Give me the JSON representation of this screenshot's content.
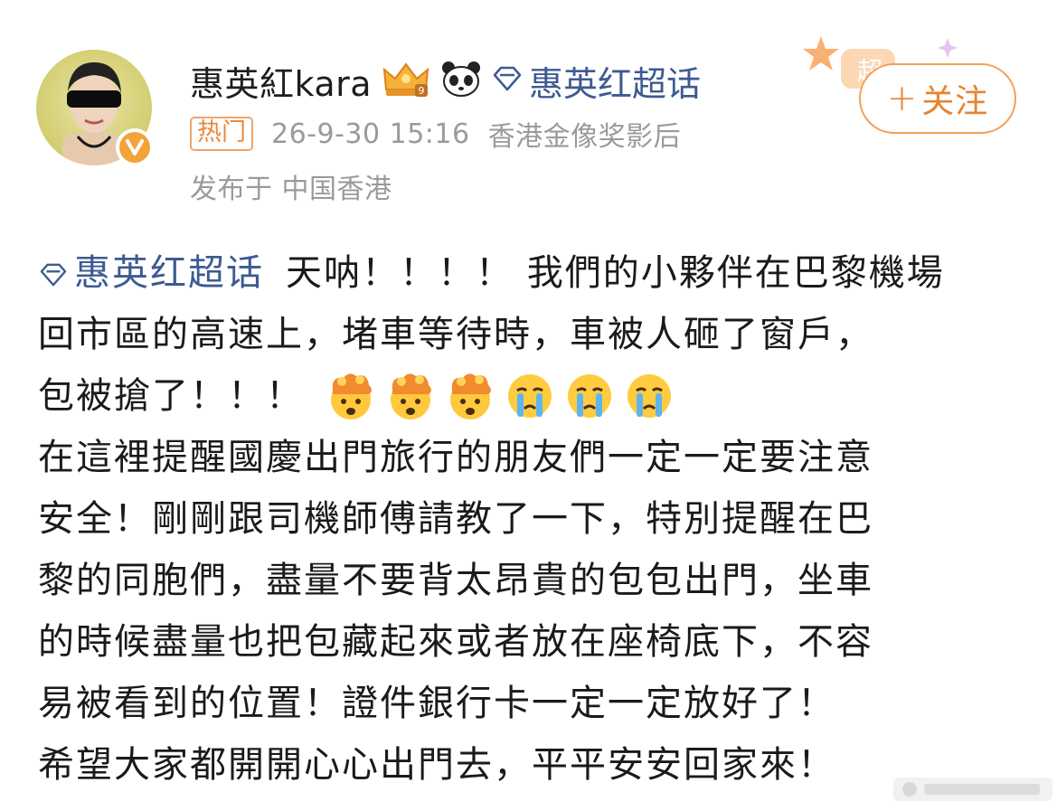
{
  "header": {
    "username": "惠英紅kara",
    "topic_name": "惠英红超话",
    "hot_tag": "热门",
    "timestamp": "26-9-30 15:16",
    "user_title": "香港金像奖影后",
    "location": "发布于 中国香港",
    "follow_plus": "+",
    "follow_label": "关注",
    "decor_text": "超"
  },
  "post": {
    "topic": "惠英红超话",
    "line1_text": "天呐！！！！ 我們的小夥伴在巴黎機場",
    "line2": "回市區的高速上，堵車等待時，車被人砸了窗戶，",
    "line3_text": "包被搶了！！！",
    "emojis": [
      "exploding-head",
      "exploding-head",
      "exploding-head",
      "crying",
      "crying",
      "crying"
    ],
    "line4": "在這裡提醒國慶出門旅行的朋友們一定一定要注意",
    "line5": "安全！剛剛跟司機師傅請教了一下，特別提醒在巴",
    "line6": "黎的同胞們，盡量不要背太昂貴的包包出門，坐車",
    "line7": "的時候盡量也把包藏起來或者放在座椅底下，不容",
    "line8": "易被看到的位置！證件銀行卡一定一定放好了！",
    "line9": "希望大家都開開心心出門去，平平安安回家來！"
  },
  "colors": {
    "link": "#3d5a92",
    "accent": "#e8832f",
    "meta": "#9a9a9a"
  }
}
